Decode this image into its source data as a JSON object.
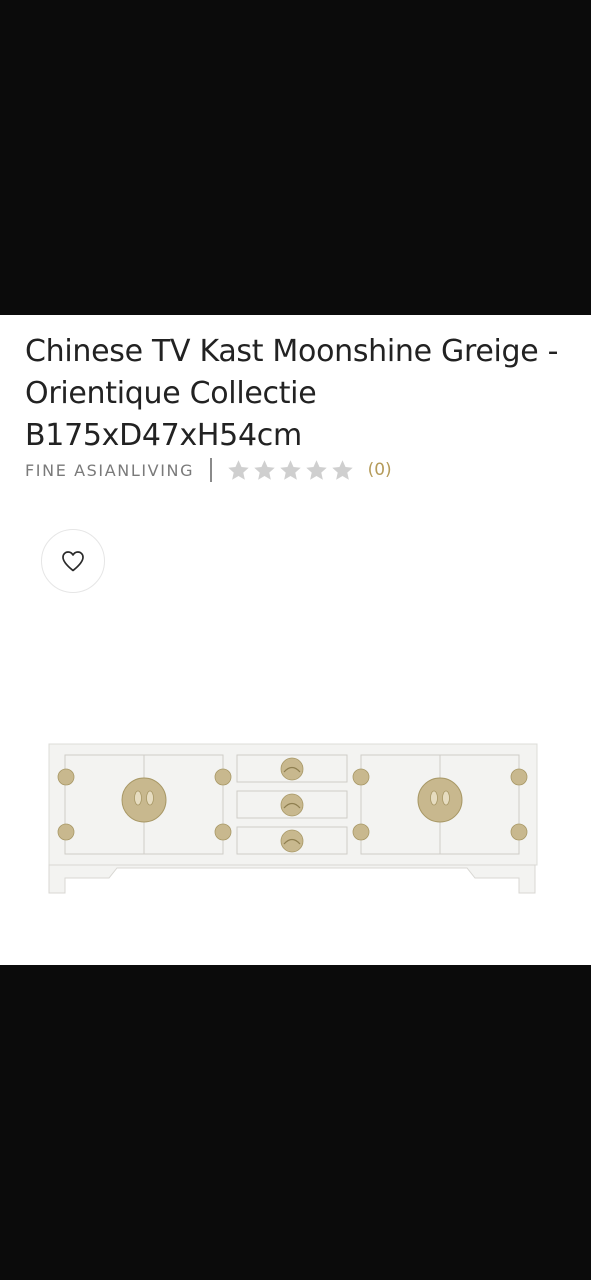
{
  "product": {
    "title": "Chinese TV Kast Moonshine Greige - Orientique Collectie B175xD47xH54cm",
    "brand": "FINE ASIANLIVING",
    "rating": 0,
    "rating_max": 5,
    "review_count_label": "(0)"
  },
  "icons": {
    "wishlist": "heart-outline-icon",
    "rating": "star-icon"
  },
  "colors": {
    "background": "#ffffff",
    "letterbox": "#0b0b0b",
    "star_empty": "#cfcfcf",
    "review_count": "#b59b5a",
    "cabinet": "#f3f3f1",
    "hardware": "#c8b88e"
  }
}
